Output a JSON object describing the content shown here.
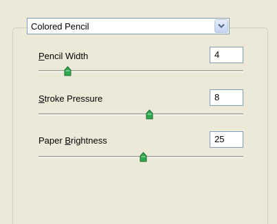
{
  "filter": {
    "selected": "Colored Pencil",
    "dropdown_icon": "chevron-down-icon"
  },
  "controls": [
    {
      "label_ul": "P",
      "label_rest": "encil Width",
      "value": "4",
      "slider_fraction": 0.14
    },
    {
      "label_ul": "S",
      "label_rest": "troke Pressure",
      "value": "8",
      "slider_fraction": 0.54
    },
    {
      "label_pre": "Paper ",
      "label_ul": "B",
      "label_rest": "rightness",
      "value": "25",
      "slider_fraction": 0.51
    }
  ],
  "colors": {
    "thumb_fill": "#2fa84f",
    "input_border": "#7f9db9",
    "panel_bg": "#ece9d8"
  }
}
